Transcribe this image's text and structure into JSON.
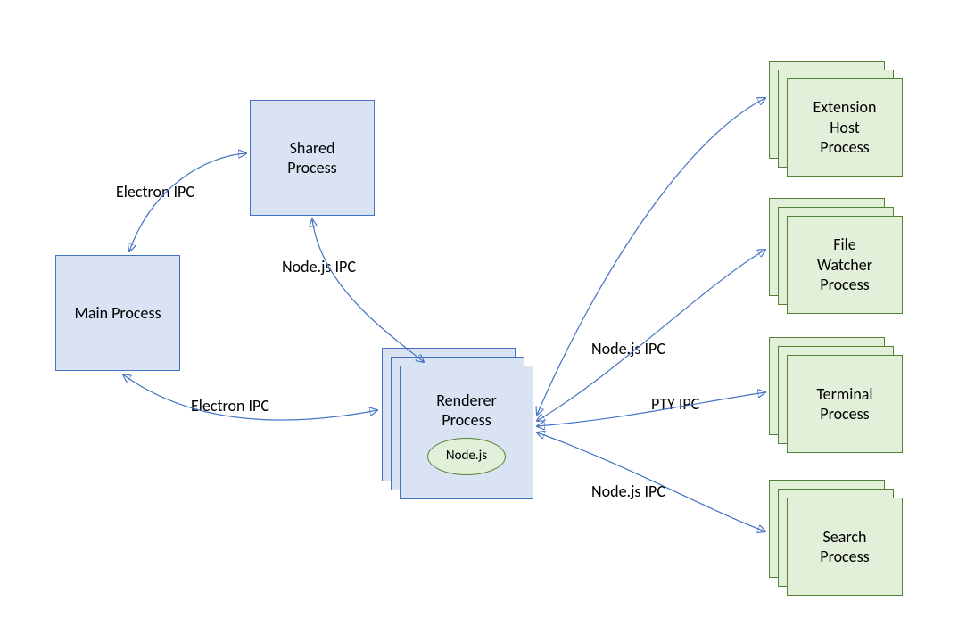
{
  "nodes": {
    "main": {
      "label": "Main Process"
    },
    "shared": {
      "label": "Shared\nProcess"
    },
    "renderer": {
      "label": "Renderer\nProcess",
      "inner": "Node.js"
    },
    "ext": {
      "label": "Extension\nHost\nProcess"
    },
    "watcher": {
      "label": "File\nWatcher\nProcess"
    },
    "terminal": {
      "label": "Terminal\nProcess"
    },
    "search": {
      "label": "Search\nProcess"
    }
  },
  "edges": {
    "main_shared": {
      "label": "Electron IPC"
    },
    "main_renderer": {
      "label": "Electron IPC"
    },
    "shared_renderer": {
      "label": "Node.js IPC"
    },
    "renderer_ipc": {
      "label": "Node.js IPC"
    },
    "renderer_pty": {
      "label": "PTY IPC"
    },
    "renderer_search": {
      "label": "Node.js IPC"
    }
  }
}
